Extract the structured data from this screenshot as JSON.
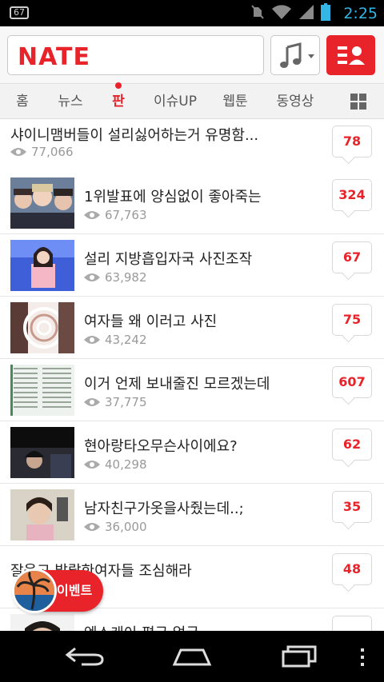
{
  "status_bar": {
    "notification_badge": "67",
    "time": "2:25",
    "icons": [
      "notification-icon",
      "muted-icon",
      "wifi-icon",
      "signal-icon",
      "battery-icon"
    ]
  },
  "header": {
    "logo": "NATE",
    "music_icon": "music-note-icon",
    "menu_icon": "profile-menu-icon"
  },
  "tabs": [
    {
      "label": "홈",
      "active": false
    },
    {
      "label": "뉴스",
      "active": false
    },
    {
      "label": "판",
      "active": true
    },
    {
      "label": "이슈UP",
      "active": false
    },
    {
      "label": "웹툰",
      "active": false
    },
    {
      "label": "동영상",
      "active": false
    }
  ],
  "posts": [
    {
      "title": "샤이니맴버들이 설리싫어하는거 유명함...",
      "views": "77,066",
      "comments": "78",
      "thumb": null
    },
    {
      "title": "1위발표에 양심없이 좋아죽는",
      "views": "67,763",
      "comments": "324",
      "thumb": "group-photo"
    },
    {
      "title": "설리 지방흡입자국 사진조작",
      "views": "63,982",
      "comments": "67",
      "thumb": "stage-photo"
    },
    {
      "title": "여자들 왜 이러고 사진",
      "views": "43,242",
      "comments": "75",
      "thumb": "swirl-photo"
    },
    {
      "title": "이거 언제 보내줄진 모르겠는데",
      "views": "37,775",
      "comments": "607",
      "thumb": "document-photo"
    },
    {
      "title": "현아랑타오무슨사이에요?",
      "views": "40,298",
      "comments": "62",
      "thumb": "dark-photo"
    },
    {
      "title": "남자친구가옷을사줬는데..;",
      "views": "36,000",
      "comments": "35",
      "thumb": "selfie-photo"
    },
    {
      "title": "잘웃고 발랄한여자들 조심해라",
      "views": "",
      "comments": "48",
      "thumb": null
    },
    {
      "title": "엑스케이 평균 얼굴",
      "views": "",
      "comments": "",
      "thumb": "face-photo"
    }
  ],
  "event_button": {
    "label": "이벤트"
  },
  "nav_bar": {
    "icons": [
      "back-icon",
      "home-icon",
      "recent-apps-icon",
      "overflow-menu-icon"
    ]
  },
  "colors": {
    "accent": "#e8232a",
    "status_text": "#33b5e5"
  }
}
